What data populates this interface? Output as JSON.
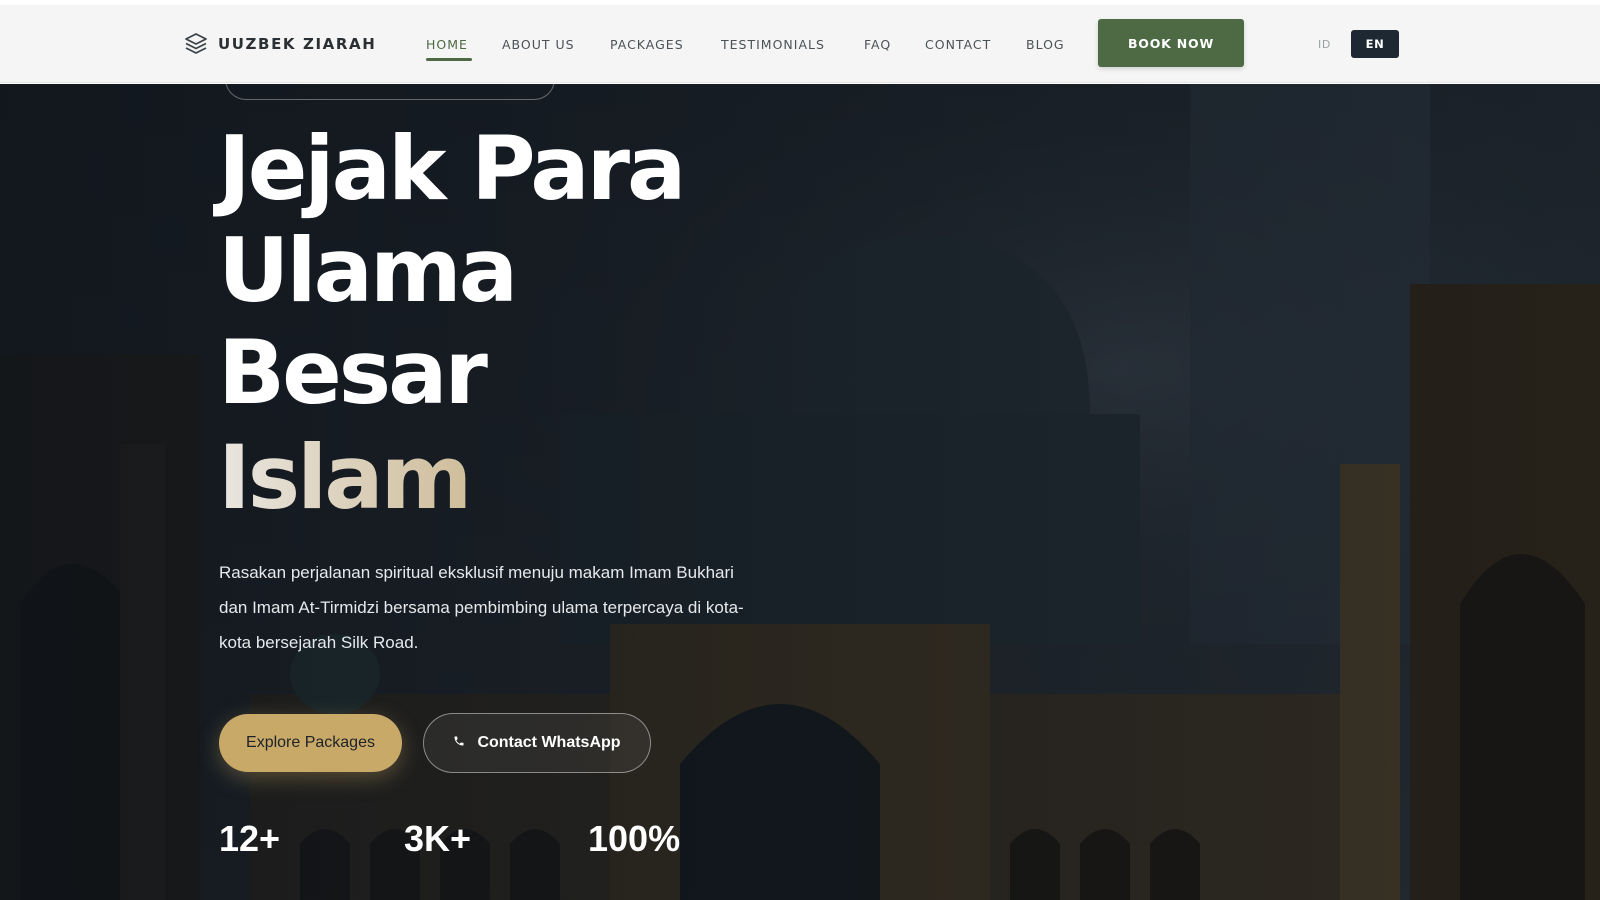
{
  "brand": {
    "name": "UUZBEK ZIARAH",
    "logo_icon": "layers-icon"
  },
  "nav": {
    "items": [
      "HOME",
      "ABOUT US",
      "PACKAGES",
      "TESTIMONIALS",
      "FAQ",
      "CONTACT",
      "BLOG"
    ],
    "active": "HOME",
    "book_label": "BOOK NOW"
  },
  "lang": {
    "id": "ID",
    "en": "EN",
    "active": "EN"
  },
  "hero": {
    "headline": [
      "Jejak Para",
      "Ulama",
      "Besar"
    ],
    "headline_accent": "Islam",
    "description": "Rasakan perjalanan spiritual eksklusif menuju makam Imam Bukhari dan Imam At-Tirmidzi bersama pembimbing ulama terpercaya di kota-kota bersejarah Silk Road.",
    "cta_primary": "Explore Packages",
    "cta_secondary": "Contact WhatsApp",
    "cta_secondary_icon": "phone-icon",
    "stats": [
      "12+",
      "3K+",
      "100%"
    ]
  },
  "colors": {
    "brand_green": "#4e6a44",
    "gold": "#c9a968",
    "dark": "#1d2833",
    "header_bg": "#f4f5f4"
  }
}
